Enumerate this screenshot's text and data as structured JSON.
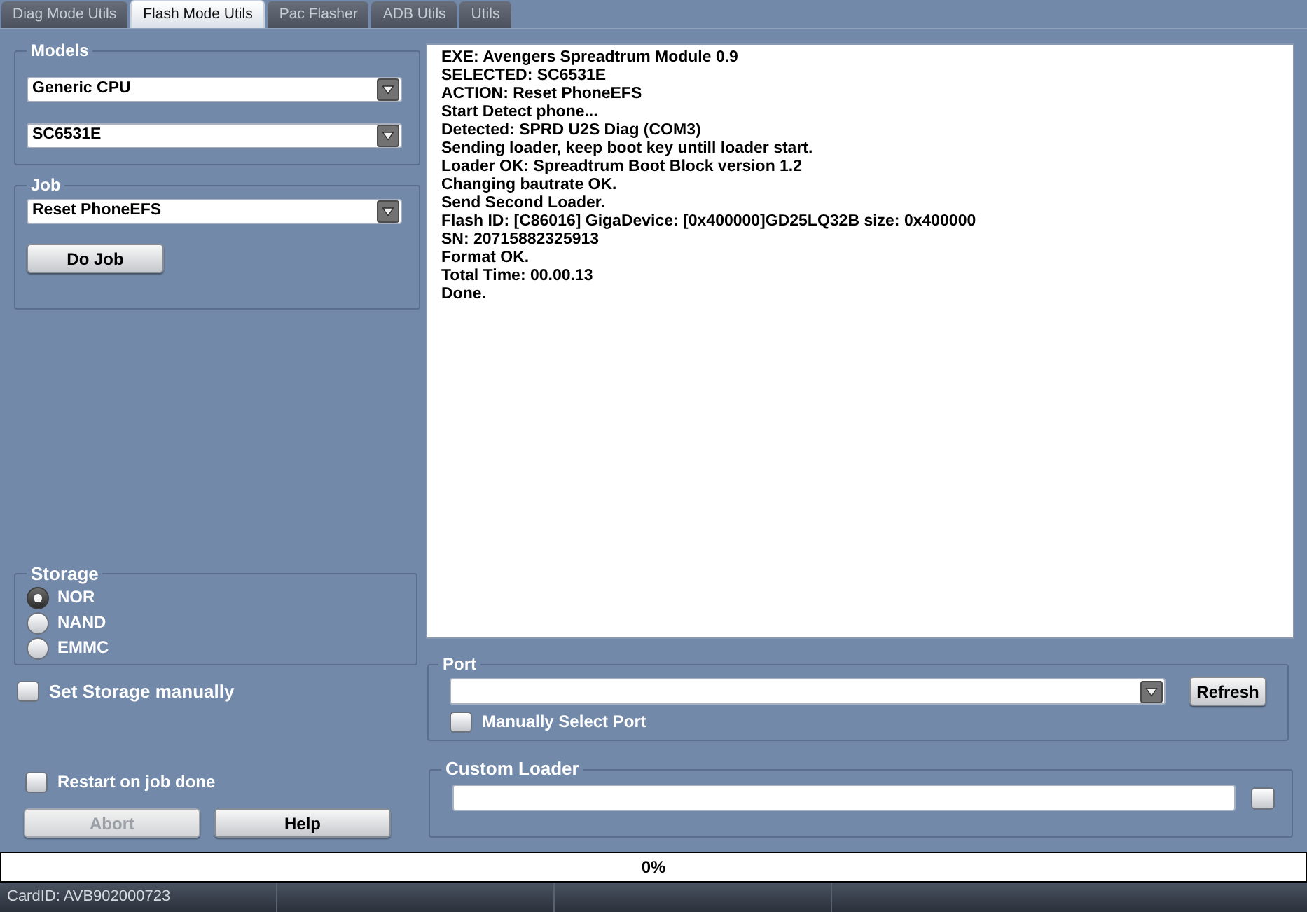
{
  "tabs": [
    {
      "label": "Diag Mode Utils",
      "selected": false
    },
    {
      "label": "Flash Mode Utils",
      "selected": true
    },
    {
      "label": "Pac Flasher",
      "selected": false
    },
    {
      "label": "ADB Utils",
      "selected": false
    },
    {
      "label": "Utils",
      "selected": false
    }
  ],
  "models": {
    "title": "Models",
    "dropdowns": [
      "Generic CPU",
      "SC6531E"
    ]
  },
  "job": {
    "title": "Job",
    "dropdown": "Reset PhoneEFS",
    "button": "Do Job"
  },
  "storage": {
    "title": "Storage",
    "options": [
      {
        "label": "NOR",
        "selected": true
      },
      {
        "label": "NAND",
        "selected": false
      },
      {
        "label": "EMMC",
        "selected": false
      }
    ]
  },
  "set_storage_manually": {
    "label": "Set Storage manually",
    "checked": false
  },
  "restart_on_job_done": {
    "label": "Restart on job done",
    "checked": false
  },
  "buttons": [
    {
      "label": "Abort",
      "disabled": true
    },
    {
      "label": "Help",
      "disabled": false
    }
  ],
  "log": [
    "EXE: Avengers Spreadtrum Module 0.9",
    "SELECTED: SC6531E",
    "ACTION: Reset PhoneEFS",
    "Start Detect phone...",
    "Detected: SPRD U2S Diag (COM3)",
    "Sending loader, keep boot key untill loader start.",
    "Loader OK: Spreadtrum Boot Block version 1.2",
    "Changing bautrate OK.",
    "Send Second Loader.",
    "Flash ID: [C86016] GigaDevice: [0x400000]GD25LQ32B size: 0x400000",
    "SN: 20715882325913",
    "Format OK.",
    "Total Time: 00.00.13",
    "Done."
  ],
  "port": {
    "title": "Port",
    "button": "Refresh",
    "manual_select": {
      "label": "Manually Select Port",
      "checked": false
    }
  },
  "custom_loader": {
    "title": "Custom Loader",
    "checked": false
  },
  "progress": {
    "level": 0,
    "label": "0%"
  },
  "status_bar": {
    "card_id": "CardID: AVB902000723"
  }
}
